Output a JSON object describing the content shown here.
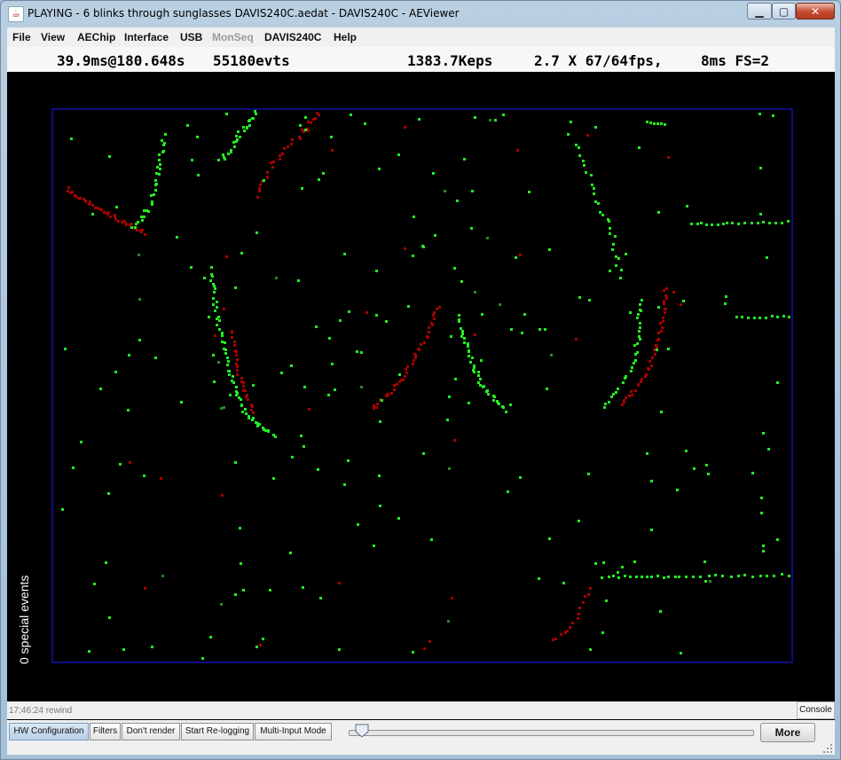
{
  "window": {
    "title": "PLAYING - 6 blinks through sunglasses DAVIS240C.aedat - DAVIS240C - AEViewer",
    "app_icon": "java-cup-icon",
    "minimize_icon": "minimize-icon",
    "maximize_icon": "maximize-icon",
    "close_icon": "close-icon"
  },
  "menubar": {
    "items": [
      {
        "label": "File",
        "enabled": true
      },
      {
        "label": "View",
        "enabled": true
      },
      {
        "label": "AEChip",
        "enabled": true
      },
      {
        "label": "Interface",
        "enabled": true
      },
      {
        "label": "USB",
        "enabled": true
      },
      {
        "label": "MonSeq",
        "enabled": false
      },
      {
        "label": "DAVIS240C",
        "enabled": true
      },
      {
        "label": "Help",
        "enabled": true
      }
    ]
  },
  "status": {
    "time": "39.9ms@180.648s",
    "events": "55180evts",
    "rate": "1383.7Keps",
    "fps": "2.7 X 67/64fps,",
    "frame": "8ms FS=2"
  },
  "display": {
    "special_events": "0 special events",
    "background": "#000000",
    "frame_color": "#1a1aff",
    "on_color": "#22ee22",
    "off_color": "#aa0000"
  },
  "log": {
    "text": "17:46:24 rewind",
    "console_label": "Console"
  },
  "toolbar": {
    "hw_config": "HW Configuration",
    "filters": "Filters",
    "dont_render": "Don't render",
    "start_relogging": "Start Re-logging",
    "multi_input": "Multi-Input Mode",
    "more": "More",
    "playback_position": 0.02
  }
}
